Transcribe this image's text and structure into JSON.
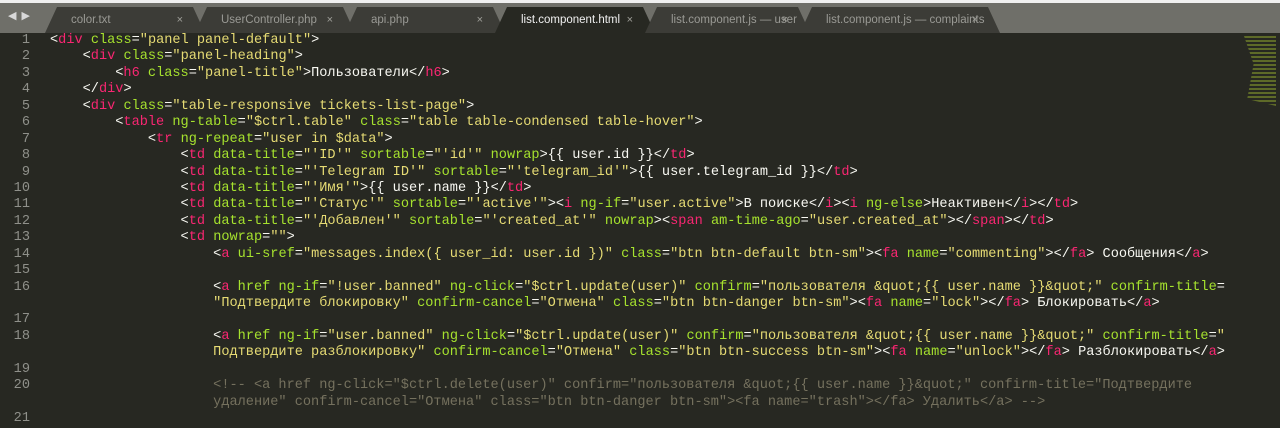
{
  "tabs": [
    {
      "label": "color.txt",
      "active": false
    },
    {
      "label": "UserController.php",
      "active": false
    },
    {
      "label": "api.php",
      "active": false
    },
    {
      "label": "list.component.html",
      "active": true
    },
    {
      "label": "list.component.js — user",
      "active": false
    },
    {
      "label": "list.component.js — complaints",
      "active": false
    }
  ],
  "nav_icon": "◀ ▶",
  "close_glyph": "×",
  "lines": [
    {
      "n": "1",
      "rows": [
        "<div class=\"panel panel-default\">"
      ]
    },
    {
      "n": "2",
      "rows": [
        "    <div class=\"panel-heading\">"
      ]
    },
    {
      "n": "3",
      "rows": [
        "        <h6 class=\"panel-title\">Пользователи</h6>"
      ]
    },
    {
      "n": "4",
      "rows": [
        "    </div>"
      ]
    },
    {
      "n": "5",
      "rows": [
        "    <div class=\"table-responsive tickets-list-page\">"
      ]
    },
    {
      "n": "6",
      "rows": [
        "        <table ng-table=\"$ctrl.table\" class=\"table table-condensed table-hover\">"
      ]
    },
    {
      "n": "7",
      "rows": [
        "            <tr ng-repeat=\"user in $data\">"
      ]
    },
    {
      "n": "8",
      "rows": [
        "                <td data-title=\"'ID'\" sortable=\"'id'\" nowrap>{{ user.id }}</td>"
      ]
    },
    {
      "n": "9",
      "rows": [
        "                <td data-title=\"'Telegram ID'\" sortable=\"'telegram_id'\">{{ user.telegram_id }}</td>"
      ]
    },
    {
      "n": "10",
      "rows": [
        "                <td data-title=\"'Имя'\">{{ user.name }}</td>"
      ]
    },
    {
      "n": "11",
      "rows": [
        "                <td data-title=\"'Статус'\" sortable=\"'active'\"><i ng-if=\"user.active\">В поиске</i><i ng-else>Неактивен</i></td>"
      ]
    },
    {
      "n": "12",
      "rows": [
        "                <td data-title=\"'Добавлен'\" sortable=\"'created_at'\" nowrap><span am-time-ago=\"user.created_at\"></span></td>"
      ]
    },
    {
      "n": "13",
      "rows": [
        "                <td nowrap=\"\">"
      ]
    },
    {
      "n": "14",
      "rows": [
        "                    <a ui-sref=\"messages.index({ user_id: user.id })\" class=\"btn btn-default btn-sm\"><fa name=\"commenting\"></fa> Сообщения</a>"
      ]
    },
    {
      "n": "15",
      "rows": [
        ""
      ]
    },
    {
      "n": "16",
      "rows": [
        "                    <a href ng-if=\"!user.banned\" ng-click=\"$ctrl.update(user)\" confirm=\"пользователя &quot;{{ user.name }}&quot;\" confirm-title=",
        "\"Подтвердите блокировку\" confirm-cancel=\"Отмена\" class=\"btn btn-danger btn-sm\"><fa name=\"lock\"></fa> Блокировать</a>"
      ]
    },
    {
      "n": "17",
      "rows": [
        ""
      ]
    },
    {
      "n": "18",
      "rows": [
        "                    <a href ng-if=\"user.banned\" ng-click=\"$ctrl.update(user)\" confirm=\"пользователя &quot;{{ user.name }}&quot;\" confirm-title=\"",
        "Подтвердите разблокировку\" confirm-cancel=\"Отмена\" class=\"btn btn-success btn-sm\"><fa name=\"unlock\"></fa> Разблокировать</a>"
      ]
    },
    {
      "n": "19",
      "rows": [
        ""
      ]
    },
    {
      "n": "20",
      "rows": [
        "                    <!-- <a href ng-click=\"$ctrl.delete(user)\" confirm=\"пользователя &quot;{{ user.name }}&quot;\" confirm-title=\"Подтвердите",
        "удаление\" confirm-cancel=\"Отмена\" class=\"btn btn-danger btn-sm\"><fa name=\"trash\"></fa> Удалить</a> -->"
      ]
    },
    {
      "n": "21",
      "rows": [
        ""
      ]
    }
  ]
}
